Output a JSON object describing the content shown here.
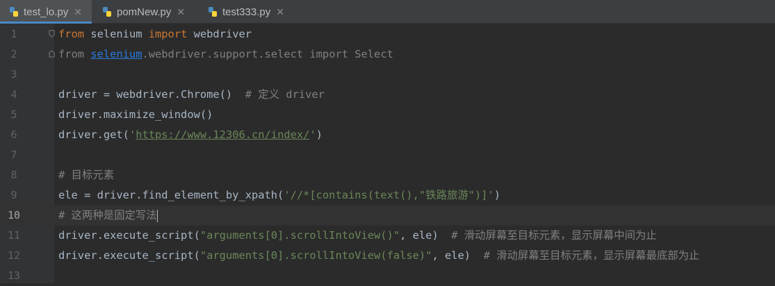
{
  "tabs": [
    {
      "label": "test_lo.py",
      "active": true
    },
    {
      "label": "pomNew.py",
      "active": false
    },
    {
      "label": "test333.py",
      "active": false
    }
  ],
  "line_numbers": [
    "1",
    "2",
    "3",
    "4",
    "5",
    "6",
    "7",
    "8",
    "9",
    "10",
    "11",
    "12",
    "13"
  ],
  "current_line": "10",
  "code": {
    "l1": {
      "kw1": "from",
      "mod": " selenium ",
      "kw2": "import",
      "name": " webdriver"
    },
    "l2": {
      "kw1": "from ",
      "mod": "selenium",
      "rest": ".webdriver.support.select import Select"
    },
    "l4": {
      "code": "driver = webdriver.Chrome()  ",
      "comment": "# 定义 driver"
    },
    "l5": {
      "code": "driver.maximize_window()"
    },
    "l6": {
      "pre": "driver.get(",
      "q1": "'",
      "url": "https://www.12306.cn/index/",
      "q2": "'",
      "post": ")"
    },
    "l8": {
      "comment": "# 目标元素"
    },
    "l9": {
      "pre": "ele = driver.find_element_by_xpath(",
      "str": "'//*[contains(text(),\"铁路旅游\")]'",
      "post": ")"
    },
    "l10": {
      "comment": "# 这两种是固定写法"
    },
    "l11": {
      "pre": "driver.execute_script(",
      "str": "\"arguments[0].scrollIntoView()\"",
      "post": ", ele)  ",
      "comment": "# 滑动屏幕至目标元素，显示屏幕中间为止"
    },
    "l12": {
      "pre": "driver.execute_script(",
      "str": "\"arguments[0].scrollIntoView(false)\"",
      "post": ", ele)  ",
      "comment": "# 滑动屏幕至目标元素，显示屏幕最底部为止"
    }
  },
  "colors": {
    "background": "#2b2b2b",
    "keyword": "#cc7832",
    "string": "#6a8759",
    "comment": "#808080",
    "text": "#a9b7c6",
    "tab_underline": "#4a88c7"
  },
  "icons": {
    "tab_icon": "python-file-icon",
    "close": "close-icon",
    "fold": "fold-marker-icon"
  }
}
